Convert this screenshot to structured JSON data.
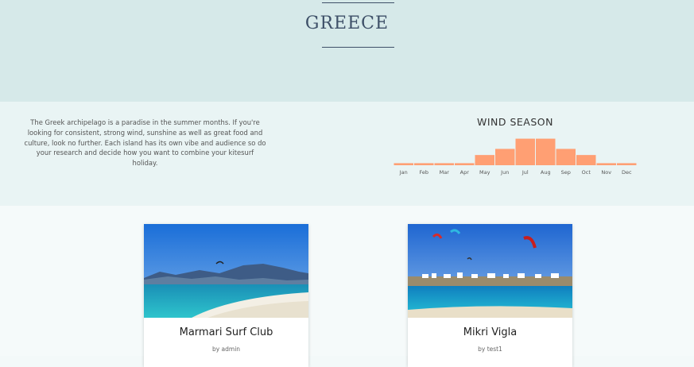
{
  "hero": {
    "title": "GREECE"
  },
  "intro": {
    "text": "The Greek archipelago is a paradise in the summer months. If you're looking for consistent, strong wind, sunshine as well as great food and culture, look no further. Each island has its own vibe and audience so do your research and decide how you want to combine your kitesurf holiday."
  },
  "wind": {
    "title": "WIND SEASON"
  },
  "chart_data": {
    "type": "bar",
    "title": "WIND SEASON",
    "categories": [
      "Jan",
      "Feb",
      "Mar",
      "Apr",
      "May",
      "Jun",
      "Jul",
      "Aug",
      "Sep",
      "Oct",
      "Nov",
      "Dec"
    ],
    "values": [
      1,
      1,
      1,
      1,
      5,
      8,
      13,
      13,
      8,
      5,
      1,
      1
    ],
    "ylim": [
      0,
      14
    ],
    "grid": false,
    "color": "#ff9f73"
  },
  "spots": [
    {
      "title": "Marmari Surf Club",
      "author": "by admin"
    },
    {
      "title": "Mikri Vigla",
      "author": "by test1"
    }
  ]
}
